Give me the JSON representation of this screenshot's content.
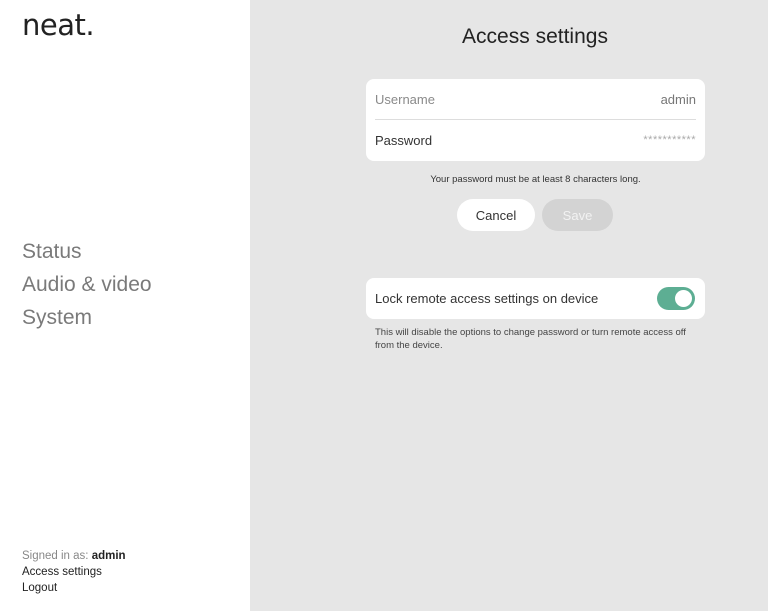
{
  "sidebar": {
    "logo": "neat.",
    "nav": [
      "Status",
      "Audio & video",
      "System"
    ],
    "signed_in_label": "Signed in as:",
    "signed_in_user": "admin",
    "access_settings": "Access settings",
    "logout": "Logout"
  },
  "main": {
    "title": "Access settings",
    "username_label": "Username",
    "username_value": "admin",
    "password_label": "Password",
    "password_value": "***********",
    "hint": "Your password must be at least 8 characters long.",
    "cancel_label": "Cancel",
    "save_label": "Save",
    "lock_label": "Lock remote access settings on device",
    "lock_enabled": true,
    "lock_note": "This will disable the options to change password or turn remote access off from the device."
  },
  "colors": {
    "toggle_on": "#5dae93",
    "main_bg": "#e6e6e6"
  }
}
